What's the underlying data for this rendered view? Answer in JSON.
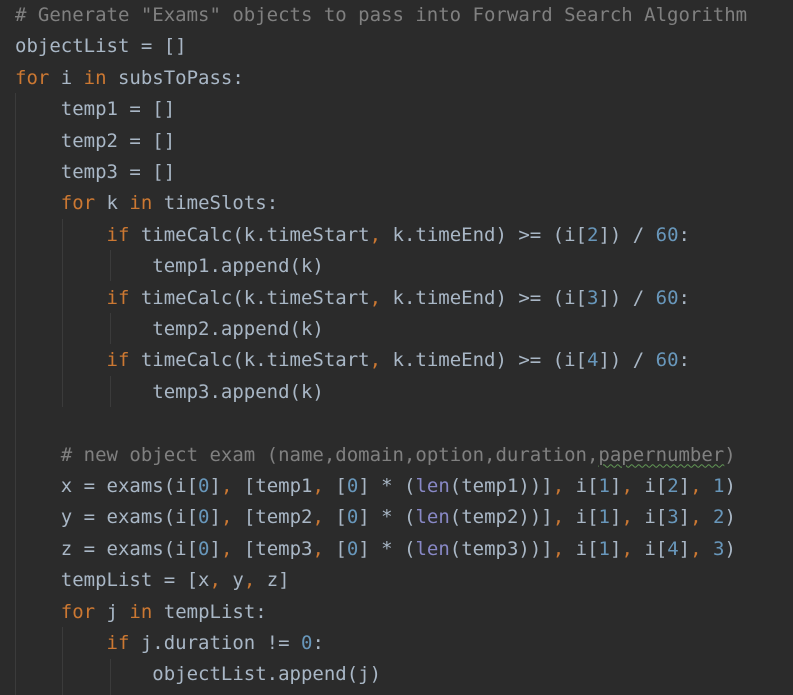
{
  "editor": {
    "lines": [
      [
        {
          "t": "# Generate \"Exams\" objects to pass into Forward Search Algorithm",
          "c": "comment"
        }
      ],
      [
        {
          "t": "objectList = []",
          "c": ""
        }
      ],
      [
        {
          "t": "for",
          "c": "kw"
        },
        {
          "t": " i ",
          "c": ""
        },
        {
          "t": "in",
          "c": "kw"
        },
        {
          "t": " subsToPass:",
          "c": ""
        }
      ],
      [
        {
          "t": "    temp1 = []",
          "c": ""
        }
      ],
      [
        {
          "t": "    temp2 = []",
          "c": ""
        }
      ],
      [
        {
          "t": "    temp3 = []",
          "c": ""
        }
      ],
      [
        {
          "t": "    ",
          "c": ""
        },
        {
          "t": "for",
          "c": "kw"
        },
        {
          "t": " k ",
          "c": ""
        },
        {
          "t": "in",
          "c": "kw"
        },
        {
          "t": " timeSlots:",
          "c": ""
        }
      ],
      [
        {
          "t": "        ",
          "c": ""
        },
        {
          "t": "if",
          "c": "kw"
        },
        {
          "t": " timeCalc(k.timeStart",
          "c": ""
        },
        {
          "t": ",",
          "c": "kw"
        },
        {
          "t": " k.timeEnd) >= (i[",
          "c": ""
        },
        {
          "t": "2",
          "c": "num"
        },
        {
          "t": "]) / ",
          "c": ""
        },
        {
          "t": "60",
          "c": "num"
        },
        {
          "t": ":",
          "c": ""
        }
      ],
      [
        {
          "t": "            temp1.append(k)",
          "c": ""
        }
      ],
      [
        {
          "t": "        ",
          "c": ""
        },
        {
          "t": "if",
          "c": "kw"
        },
        {
          "t": " timeCalc(k.timeStart",
          "c": ""
        },
        {
          "t": ",",
          "c": "kw"
        },
        {
          "t": " k.timeEnd) >= (i[",
          "c": ""
        },
        {
          "t": "3",
          "c": "num"
        },
        {
          "t": "]) / ",
          "c": ""
        },
        {
          "t": "60",
          "c": "num"
        },
        {
          "t": ":",
          "c": ""
        }
      ],
      [
        {
          "t": "            temp2.append(k)",
          "c": ""
        }
      ],
      [
        {
          "t": "        ",
          "c": ""
        },
        {
          "t": "if",
          "c": "kw"
        },
        {
          "t": " timeCalc(k.timeStart",
          "c": ""
        },
        {
          "t": ",",
          "c": "kw"
        },
        {
          "t": " k.timeEnd) >= (i[",
          "c": ""
        },
        {
          "t": "4",
          "c": "num"
        },
        {
          "t": "]) / ",
          "c": ""
        },
        {
          "t": "60",
          "c": "num"
        },
        {
          "t": ":",
          "c": ""
        }
      ],
      [
        {
          "t": "            temp3.append(k)",
          "c": ""
        }
      ],
      [
        {
          "t": "",
          "c": ""
        }
      ],
      [
        {
          "t": "    ",
          "c": ""
        },
        {
          "t": "# new object exam (name,domain,option,duration,",
          "c": "comment"
        },
        {
          "t": "papernumber",
          "c": "comment squig"
        },
        {
          "t": ")",
          "c": "comment"
        }
      ],
      [
        {
          "t": "    x = exams(i[",
          "c": ""
        },
        {
          "t": "0",
          "c": "num"
        },
        {
          "t": "]",
          "c": ""
        },
        {
          "t": ",",
          "c": "kw"
        },
        {
          "t": " [temp1",
          "c": ""
        },
        {
          "t": ",",
          "c": "kw"
        },
        {
          "t": " [",
          "c": ""
        },
        {
          "t": "0",
          "c": "num"
        },
        {
          "t": "] * (",
          "c": ""
        },
        {
          "t": "len",
          "c": "builtin"
        },
        {
          "t": "(temp1))]",
          "c": ""
        },
        {
          "t": ",",
          "c": "kw"
        },
        {
          "t": " i[",
          "c": ""
        },
        {
          "t": "1",
          "c": "num"
        },
        {
          "t": "]",
          "c": ""
        },
        {
          "t": ",",
          "c": "kw"
        },
        {
          "t": " i[",
          "c": ""
        },
        {
          "t": "2",
          "c": "num"
        },
        {
          "t": "]",
          "c": ""
        },
        {
          "t": ",",
          "c": "kw"
        },
        {
          "t": " ",
          "c": ""
        },
        {
          "t": "1",
          "c": "num"
        },
        {
          "t": ")",
          "c": ""
        }
      ],
      [
        {
          "t": "    y = exams(i[",
          "c": ""
        },
        {
          "t": "0",
          "c": "num"
        },
        {
          "t": "]",
          "c": ""
        },
        {
          "t": ",",
          "c": "kw"
        },
        {
          "t": " [temp2",
          "c": ""
        },
        {
          "t": ",",
          "c": "kw"
        },
        {
          "t": " [",
          "c": ""
        },
        {
          "t": "0",
          "c": "num"
        },
        {
          "t": "] * (",
          "c": ""
        },
        {
          "t": "len",
          "c": "builtin"
        },
        {
          "t": "(temp2))]",
          "c": ""
        },
        {
          "t": ",",
          "c": "kw"
        },
        {
          "t": " i[",
          "c": ""
        },
        {
          "t": "1",
          "c": "num"
        },
        {
          "t": "]",
          "c": ""
        },
        {
          "t": ",",
          "c": "kw"
        },
        {
          "t": " i[",
          "c": ""
        },
        {
          "t": "3",
          "c": "num"
        },
        {
          "t": "]",
          "c": ""
        },
        {
          "t": ",",
          "c": "kw"
        },
        {
          "t": " ",
          "c": ""
        },
        {
          "t": "2",
          "c": "num"
        },
        {
          "t": ")",
          "c": ""
        }
      ],
      [
        {
          "t": "    z = exams(i[",
          "c": ""
        },
        {
          "t": "0",
          "c": "num"
        },
        {
          "t": "]",
          "c": ""
        },
        {
          "t": ",",
          "c": "kw"
        },
        {
          "t": " [temp3",
          "c": ""
        },
        {
          "t": ",",
          "c": "kw"
        },
        {
          "t": " [",
          "c": ""
        },
        {
          "t": "0",
          "c": "num"
        },
        {
          "t": "] * (",
          "c": ""
        },
        {
          "t": "len",
          "c": "builtin"
        },
        {
          "t": "(temp3))]",
          "c": ""
        },
        {
          "t": ",",
          "c": "kw"
        },
        {
          "t": " i[",
          "c": ""
        },
        {
          "t": "1",
          "c": "num"
        },
        {
          "t": "]",
          "c": ""
        },
        {
          "t": ",",
          "c": "kw"
        },
        {
          "t": " i[",
          "c": ""
        },
        {
          "t": "4",
          "c": "num"
        },
        {
          "t": "]",
          "c": ""
        },
        {
          "t": ",",
          "c": "kw"
        },
        {
          "t": " ",
          "c": ""
        },
        {
          "t": "3",
          "c": "num"
        },
        {
          "t": ")",
          "c": ""
        }
      ],
      [
        {
          "t": "    tempList = [x",
          "c": ""
        },
        {
          "t": ",",
          "c": "kw"
        },
        {
          "t": " y",
          "c": ""
        },
        {
          "t": ",",
          "c": "kw"
        },
        {
          "t": " z]",
          "c": ""
        }
      ],
      [
        {
          "t": "    ",
          "c": ""
        },
        {
          "t": "for",
          "c": "kw"
        },
        {
          "t": " j ",
          "c": ""
        },
        {
          "t": "in",
          "c": "kw"
        },
        {
          "t": " tempList:",
          "c": ""
        }
      ],
      [
        {
          "t": "        ",
          "c": ""
        },
        {
          "t": "if",
          "c": "kw"
        },
        {
          "t": " j.duration != ",
          "c": ""
        },
        {
          "t": "0",
          "c": "num"
        },
        {
          "t": ":",
          "c": ""
        }
      ],
      [
        {
          "t": "            objectList.append(j)",
          "c": ""
        }
      ]
    ]
  },
  "colors": {
    "background": "#2b2b2b",
    "text": "#a9b7c6",
    "keyword": "#cc7832",
    "comment": "#808080",
    "number": "#6897bb",
    "builtin": "#8888c6"
  }
}
